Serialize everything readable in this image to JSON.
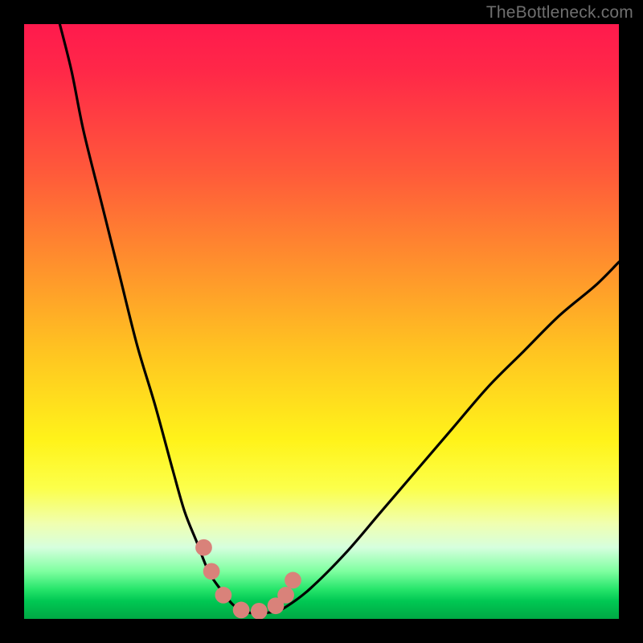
{
  "watermark": "TheBottleneck.com",
  "chart_data": {
    "type": "line",
    "title": "",
    "xlabel": "",
    "ylabel": "",
    "xlim": [
      0,
      100
    ],
    "ylim": [
      0,
      100
    ],
    "gradient_stops": [
      {
        "pct": 0,
        "color": "#ff1a4d"
      },
      {
        "pct": 25,
        "color": "#ff5a3a"
      },
      {
        "pct": 55,
        "color": "#ffc421"
      },
      {
        "pct": 78,
        "color": "#fcff4a"
      },
      {
        "pct": 92,
        "color": "#7effa0"
      },
      {
        "pct": 100,
        "color": "#00a844"
      }
    ],
    "series": [
      {
        "name": "curve",
        "color": "#000000",
        "x": [
          6,
          8,
          10,
          13,
          16,
          19,
          22,
          25,
          27,
          29,
          31,
          33,
          35,
          36.5,
          38,
          40,
          42,
          44,
          48,
          54,
          60,
          66,
          72,
          78,
          84,
          90,
          96,
          100
        ],
        "y": [
          100,
          92,
          82,
          70,
          58,
          46,
          36,
          25,
          18,
          13,
          8,
          5,
          2.5,
          1.5,
          1,
          1,
          1.2,
          2,
          5,
          11,
          18,
          25,
          32,
          39,
          45,
          51,
          56,
          60
        ]
      }
    ],
    "markers": {
      "color": "#d9827a",
      "radius_pct": 1.4,
      "points_xy": [
        [
          30.2,
          12.0
        ],
        [
          31.5,
          8.0
        ],
        [
          33.5,
          4.0
        ],
        [
          36.5,
          1.5
        ],
        [
          39.5,
          1.3
        ],
        [
          42.3,
          2.2
        ],
        [
          44.0,
          4.0
        ],
        [
          45.2,
          6.5
        ]
      ]
    }
  }
}
